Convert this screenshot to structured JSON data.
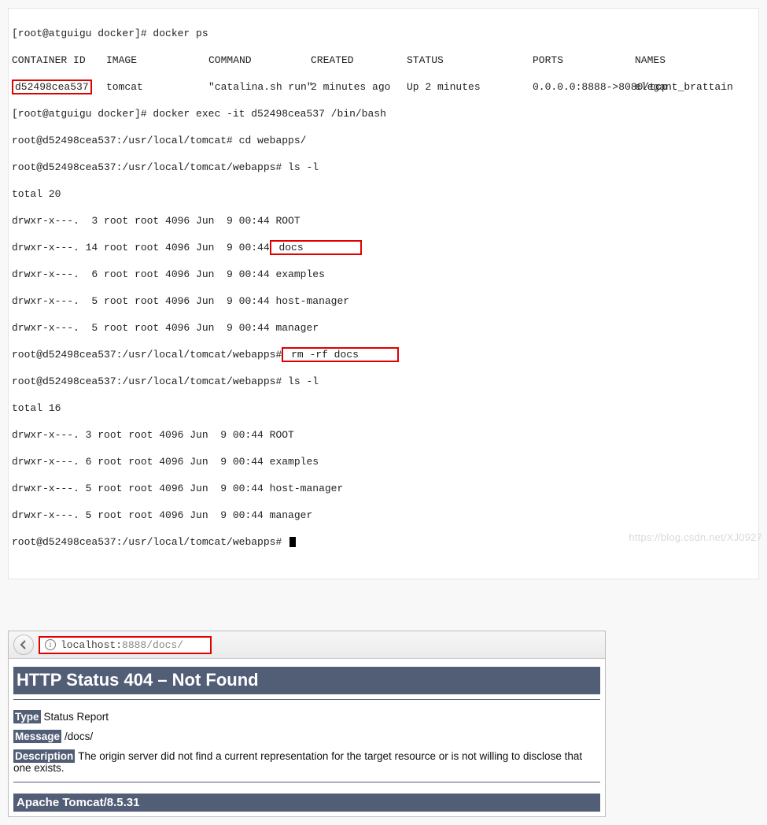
{
  "terminal": {
    "prompt1": "[root@atguigu docker]# docker ps",
    "hdr": {
      "id": "CONTAINER ID",
      "image": "IMAGE",
      "cmd": "COMMAND",
      "created": "CREATED",
      "status": "STATUS",
      "ports": "PORTS",
      "names": "NAMES"
    },
    "row": {
      "id": "d52498cea537",
      "image": "tomcat",
      "cmd": "\"catalina.sh run\"",
      "created": "2 minutes ago",
      "status": "Up 2 minutes",
      "ports": "0.0.0.0:8888->8080/tcp",
      "names": "elegant_brattain"
    },
    "exec": "[root@atguigu docker]# docker exec -it d52498cea537 /bin/bash",
    "cd": "root@d52498cea537:/usr/local/tomcat# cd webapps/",
    "ls1": "root@d52498cea537:/usr/local/tomcat/webapps# ls -l",
    "total1": "total 20",
    "r1a": "drwxr-x---.  3 root root 4096 Jun  9 00:44 ROOT",
    "r1b_left": "drwxr-x---. 14 root root 4096 Jun  9 00:44",
    "r1b_boxed": " docs         ",
    "r1c": "drwxr-x---.  6 root root 4096 Jun  9 00:44 examples",
    "r1d": "drwxr-x---.  5 root root 4096 Jun  9 00:44 host-manager",
    "r1e": "drwxr-x---.  5 root root 4096 Jun  9 00:44 manager",
    "rm_left": "root@d52498cea537:/usr/local/tomcat/webapps#",
    "rm_boxed": " rm -rf docs      ",
    "ls2": "root@d52498cea537:/usr/local/tomcat/webapps# ls -l",
    "total2": "total 16",
    "r2a": "drwxr-x---. 3 root root 4096 Jun  9 00:44 ROOT",
    "r2b": "drwxr-x---. 6 root root 4096 Jun  9 00:44 examples",
    "r2c": "drwxr-x---. 5 root root 4096 Jun  9 00:44 host-manager",
    "r2d": "drwxr-x---. 5 root root 4096 Jun  9 00:44 manager",
    "last_prompt": "root@d52498cea537:/usr/local/tomcat/webapps# "
  },
  "browser": {
    "url_dark": "localhost:",
    "url_pale": "8888/docs/",
    "h404": "HTTP Status 404 – Not Found",
    "type_lbl": "Type",
    "type_val": "Status Report",
    "msg_lbl": "Message",
    "msg_val": "/docs/",
    "desc_lbl": "Description",
    "desc_val": "The origin server did not find a current representation for the target resource or is not willing to disclose that one exists.",
    "apache": "Apache Tomcat/8.5.31"
  },
  "watermark": "https://blog.csdn.net/XJ0927"
}
